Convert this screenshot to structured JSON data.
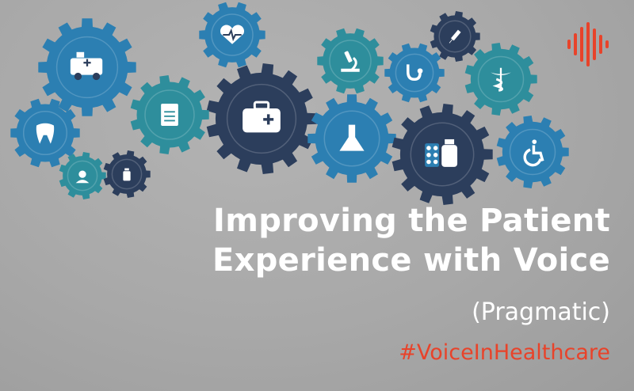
{
  "headline": {
    "line1": "Improving the Patient",
    "line2": "Experience with Voice"
  },
  "subtitle": "(Pragmatic)",
  "hashtag": "#VoiceInHealthcare",
  "colors": {
    "background": "#a9a9a9",
    "navy": "#2c3e5c",
    "blue": "#2c7fb2",
    "teal": "#2e8e9c",
    "accent": "#e8432a",
    "text": "#ffffff"
  },
  "gears": [
    {
      "icon": "ambulance-icon",
      "color": "blue"
    },
    {
      "icon": "heart-monitor-icon",
      "color": "blue"
    },
    {
      "icon": "medical-bag-icon",
      "color": "navy"
    },
    {
      "icon": "clipboard-icon",
      "color": "teal"
    },
    {
      "icon": "tooth-icon",
      "color": "blue"
    },
    {
      "icon": "nurse-icon",
      "color": "teal"
    },
    {
      "icon": "medicine-bottle-icon",
      "color": "navy"
    },
    {
      "icon": "microscope-icon",
      "color": "teal"
    },
    {
      "icon": "syringe-icon",
      "color": "navy"
    },
    {
      "icon": "stethoscope-icon",
      "color": "blue"
    },
    {
      "icon": "caduceus-icon",
      "color": "teal"
    },
    {
      "icon": "flask-icon",
      "color": "blue"
    },
    {
      "icon": "pills-icon",
      "color": "navy"
    },
    {
      "icon": "wheelchair-icon",
      "color": "blue"
    }
  ],
  "logo": {
    "icon": "soundwave-logo-icon"
  }
}
